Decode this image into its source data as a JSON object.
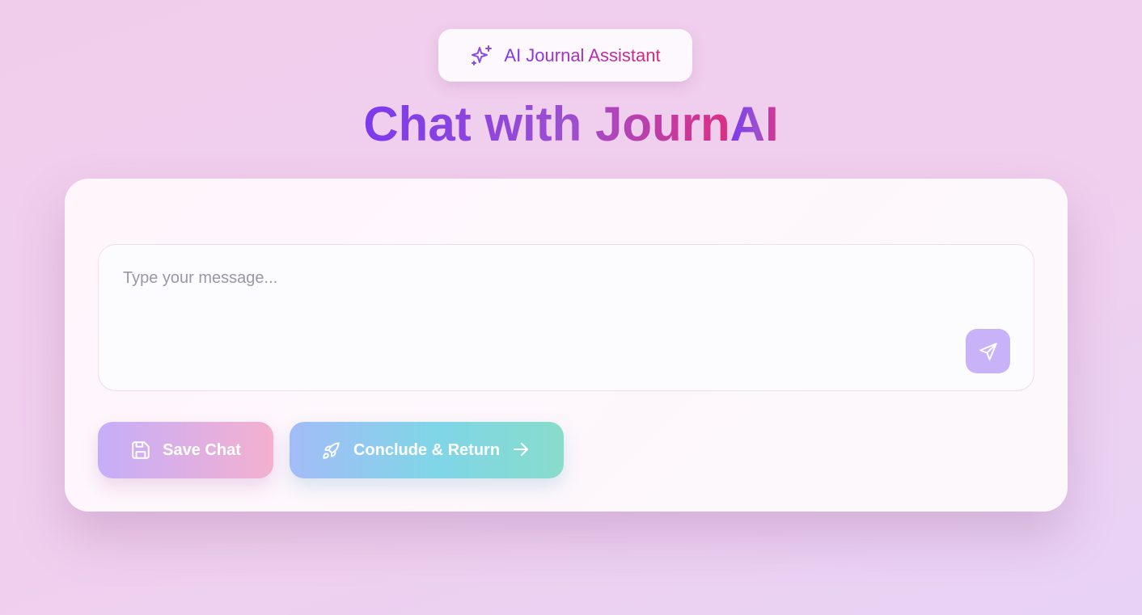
{
  "header": {
    "badge_label": "AI Journal Assistant",
    "badge_icon": "sparkles-icon",
    "title_prefix": "Chat with Journ",
    "title_suffix": "AI"
  },
  "composer": {
    "placeholder": "Type your message...",
    "value": "",
    "send_icon": "send-icon"
  },
  "actions": {
    "save_label": "Save Chat",
    "save_icon": "save-icon",
    "conclude_label": "Conclude & Return",
    "conclude_icon": "rocket-icon",
    "conclude_trailing_icon": "arrow-right-icon"
  },
  "colors": {
    "accent_purple": "#7c3aed",
    "accent_pink": "#db2777",
    "send_button": "#c9b3f8"
  }
}
